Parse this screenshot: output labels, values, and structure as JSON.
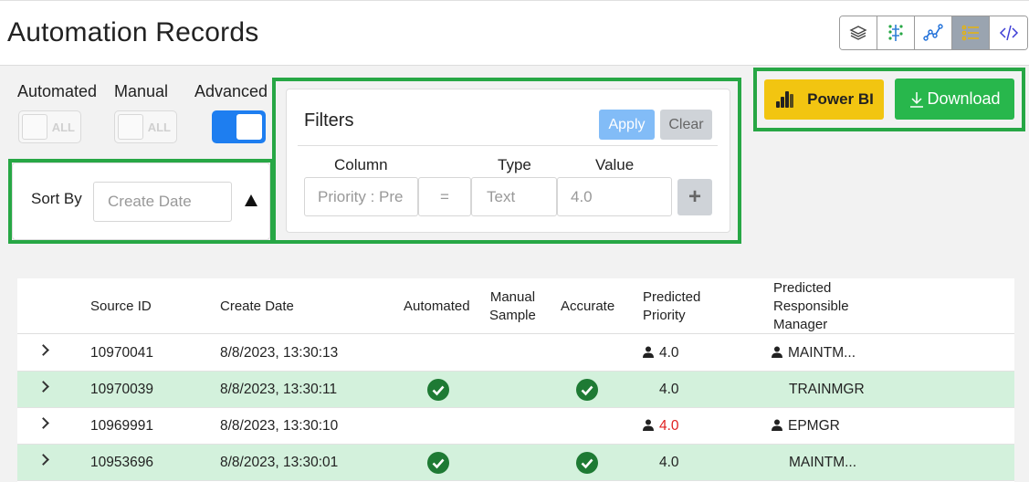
{
  "page": {
    "title": "Automation Records"
  },
  "view_switch": [
    {
      "name": "layers-icon",
      "active": false
    },
    {
      "name": "tree-icon",
      "active": false
    },
    {
      "name": "trend-icon",
      "active": false
    },
    {
      "name": "list-icon",
      "active": true
    },
    {
      "name": "code-icon",
      "active": false
    }
  ],
  "toggles": {
    "automated": {
      "label": "Automated",
      "badge": "ALL",
      "on": false
    },
    "manual": {
      "label": "Manual",
      "badge": "ALL",
      "on": false
    },
    "advanced": {
      "label": "Advanced",
      "on": true
    }
  },
  "sort": {
    "label": "Sort By",
    "placeholder": "Create Date",
    "direction": "ascending"
  },
  "filters": {
    "title": "Filters",
    "apply_label": "Apply",
    "clear_label": "Clear",
    "columns": {
      "column": "Column",
      "type": "Type",
      "value": "Value"
    },
    "row": {
      "column_placeholder": "Priority : Pre",
      "operator": "=",
      "type_placeholder": "Text",
      "value": "4.0",
      "add_label": "+"
    }
  },
  "actions": {
    "powerbi_label": "Power BI",
    "download_label": "Download"
  },
  "colors": {
    "accent_green": "#28b74c",
    "highlight_green": "#27a745",
    "powerbi_yellow": "#f2c511",
    "row_green": "#d3f1dc",
    "toggle_blue": "#1e7ef0",
    "alert_red": "#e02020"
  },
  "table": {
    "headers": {
      "source_id": "Source ID",
      "create_date": "Create Date",
      "automated": "Automated",
      "manual_1": "Manual",
      "manual_2": "Sample",
      "accurate": "Accurate",
      "pred_priority_1": "Predicted",
      "pred_priority_2": "Priority",
      "pred_mgr_1": "Predicted",
      "pred_mgr_2": "Responsible",
      "pred_mgr_3": "Manager"
    },
    "rows": [
      {
        "source_id": "10970041",
        "create_date": "8/8/2023, 13:30:13",
        "automated": false,
        "accurate": false,
        "priority": "4.0",
        "priority_red": false,
        "priority_icon": true,
        "manager": "MAINTM...",
        "manager_icon": true,
        "highlighted": false
      },
      {
        "source_id": "10970039",
        "create_date": "8/8/2023, 13:30:11",
        "automated": true,
        "accurate": true,
        "priority": "4.0",
        "priority_red": false,
        "priority_icon": false,
        "manager": "TRAINMGR",
        "manager_icon": false,
        "highlighted": true
      },
      {
        "source_id": "10969991",
        "create_date": "8/8/2023, 13:30:10",
        "automated": false,
        "accurate": false,
        "priority": "4.0",
        "priority_red": true,
        "priority_icon": true,
        "manager": "EPMGR",
        "manager_icon": true,
        "highlighted": false
      },
      {
        "source_id": "10953696",
        "create_date": "8/8/2023, 13:30:01",
        "automated": true,
        "accurate": true,
        "priority": "4.0",
        "priority_red": false,
        "priority_icon": false,
        "manager": "MAINTM...",
        "manager_icon": false,
        "highlighted": true
      }
    ]
  }
}
